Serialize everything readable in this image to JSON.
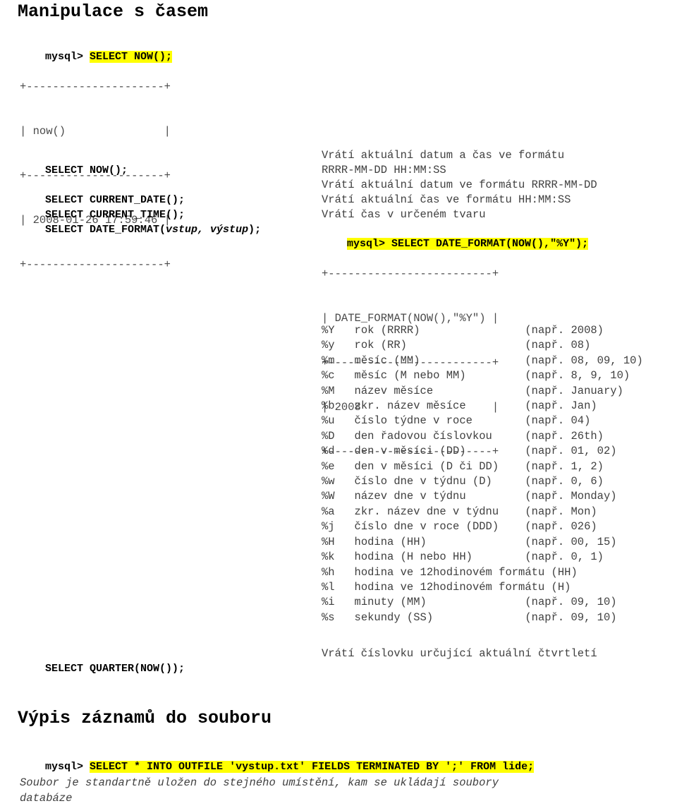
{
  "document": {
    "language": "cs",
    "title": "Manipulace s časem"
  },
  "sections": [
    {
      "id": "time-manipulation",
      "heading": "Manipulace s časem"
    },
    {
      "id": "export-to-file",
      "heading": "Výpis záznamů do souboru"
    }
  ],
  "console_now": {
    "prompt": "mysql> ",
    "command": "SELECT NOW();",
    "highlighted": true,
    "prompt_highlighted": false,
    "result_lines": [
      "+---------------------+",
      "| now()               |",
      "+---------------------+",
      "| 2008-01-26 17:59:46 |",
      "+---------------------+"
    ]
  },
  "function_rows": [
    {
      "command": "SELECT NOW();",
      "command_italic_part": "",
      "description": "Vrátí aktuální datum a čas ve formátu\nRRRR-MM-DD HH:MM:SS"
    },
    {
      "command": "SELECT CURRENT_DATE();",
      "command_italic_part": "",
      "description": "Vrátí aktuální datum ve formátu RRRR-MM-DD"
    },
    {
      "command": "SELECT CURRENT_TIME();",
      "command_italic_part": "",
      "description": "Vrátí aktuální čas ve formátu HH:MM:SS"
    },
    {
      "command_prefix": "SELECT DATE_FORMAT(",
      "command_italic_part": "vstup, výstup",
      "command_suffix": ");",
      "description": "Vrátí čas v určeném tvaru"
    }
  ],
  "console_date_format": {
    "prompt": "mysql> ",
    "command": "SELECT DATE_FORMAT(NOW(),\"%Y\");",
    "highlighted": true,
    "prompt_highlighted": true,
    "full_line": "mysql> SELECT DATE_FORMAT(NOW(),\"%Y\");",
    "result_lines": [
      "+-------------------------+",
      "| DATE_FORMAT(NOW(),\"%Y\") |",
      "+-------------------------+",
      "| 2008                    |",
      "+-------------------------+"
    ]
  },
  "format_specifiers": {
    "rows": [
      {
        "code": "%Y",
        "meaning": "rok (RRRR)",
        "example": "(např. 2008)"
      },
      {
        "code": "%y",
        "meaning": "rok (RR)",
        "example": "(např. 08)"
      },
      {
        "code": "%m",
        "meaning": "měsíc (MM)",
        "example": "(např. 08, 09, 10)"
      },
      {
        "code": "%c",
        "meaning": "měsíc (M nebo MM)",
        "example": "(např. 8, 9, 10)"
      },
      {
        "code": "%M",
        "meaning": "název měsíce",
        "example": "(např. January)"
      },
      {
        "code": "%b",
        "meaning": "zkr. název měsíce",
        "example": "(např. Jan)"
      },
      {
        "code": "%u",
        "meaning": "číslo týdne v roce",
        "example": "(např. 04)"
      },
      {
        "code": "%D",
        "meaning": "den řadovou číslovkou",
        "example": "(např. 26th)"
      },
      {
        "code": "%d",
        "meaning": "den v měsíci (DD)",
        "example": "(např. 01, 02)"
      },
      {
        "code": "%e",
        "meaning": "den v měsíci (D či DD)",
        "example": "(např. 1, 2)"
      },
      {
        "code": "%w",
        "meaning": "číslo dne v týdnu (D)",
        "example": "(např. 0, 6)"
      },
      {
        "code": "%W",
        "meaning": "název dne v týdnu",
        "example": "(např. Monday)"
      },
      {
        "code": "%a",
        "meaning": "zkr. název dne v týdnu",
        "example": "(např. Mon)"
      },
      {
        "code": "%j",
        "meaning": "číslo dne v roce (DDD)",
        "example": "(např. 026)"
      },
      {
        "code": "%H",
        "meaning": "hodina (HH)",
        "example": "(např. 00, 15)"
      },
      {
        "code": "%k",
        "meaning": "hodina (H nebo HH)",
        "example": "(např. 0, 1)"
      },
      {
        "code": "%h",
        "meaning": "hodina ve 12hodinovém formátu (HH)",
        "example": ""
      },
      {
        "code": "%l",
        "meaning": "hodina ve 12hodinovém formátu (H)",
        "example": ""
      },
      {
        "code": "%i",
        "meaning": "minuty (MM)",
        "example": "(např. 09, 10)"
      },
      {
        "code": "%s",
        "meaning": "sekundy (SS)",
        "example": "(např. 09, 10)"
      }
    ]
  },
  "quarter_row": {
    "command": "SELECT QUARTER(NOW());",
    "description": "Vrátí číslovku určující aktuální čtvrtletí"
  },
  "console_outfile": {
    "prompt": "mysql> ",
    "command": "SELECT * INTO OUTFILE 'vystup.txt' FIELDS TERMINATED BY ';' FROM lide;",
    "highlighted": true,
    "prompt_highlighted": false
  },
  "outfile_note": "Soubor je standartně uložen do stejného umístění, kam se ukládají soubory\ndatabáze",
  "colors": {
    "highlight": "#ffff00",
    "text": "#3f3f3f",
    "heading": "#000000",
    "background": "#ffffff"
  }
}
